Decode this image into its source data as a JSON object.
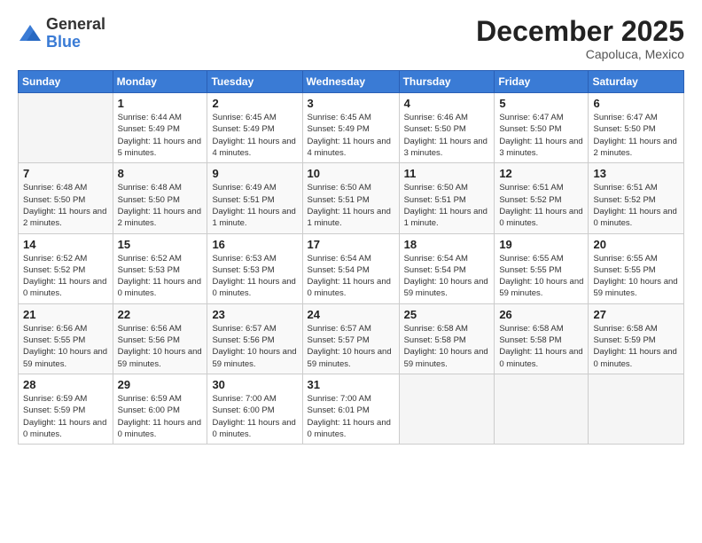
{
  "header": {
    "logo_general": "General",
    "logo_blue": "Blue",
    "month_title": "December 2025",
    "location": "Capoluca, Mexico"
  },
  "weekdays": [
    "Sunday",
    "Monday",
    "Tuesday",
    "Wednesday",
    "Thursday",
    "Friday",
    "Saturday"
  ],
  "weeks": [
    [
      {
        "day": "",
        "sunrise": "",
        "sunset": "",
        "daylight": ""
      },
      {
        "day": "1",
        "sunrise": "6:44 AM",
        "sunset": "5:49 PM",
        "daylight": "11 hours and 5 minutes."
      },
      {
        "day": "2",
        "sunrise": "6:45 AM",
        "sunset": "5:49 PM",
        "daylight": "11 hours and 4 minutes."
      },
      {
        "day": "3",
        "sunrise": "6:45 AM",
        "sunset": "5:49 PM",
        "daylight": "11 hours and 4 minutes."
      },
      {
        "day": "4",
        "sunrise": "6:46 AM",
        "sunset": "5:50 PM",
        "daylight": "11 hours and 3 minutes."
      },
      {
        "day": "5",
        "sunrise": "6:47 AM",
        "sunset": "5:50 PM",
        "daylight": "11 hours and 3 minutes."
      },
      {
        "day": "6",
        "sunrise": "6:47 AM",
        "sunset": "5:50 PM",
        "daylight": "11 hours and 2 minutes."
      }
    ],
    [
      {
        "day": "7",
        "sunrise": "6:48 AM",
        "sunset": "5:50 PM",
        "daylight": "11 hours and 2 minutes."
      },
      {
        "day": "8",
        "sunrise": "6:48 AM",
        "sunset": "5:50 PM",
        "daylight": "11 hours and 2 minutes."
      },
      {
        "day": "9",
        "sunrise": "6:49 AM",
        "sunset": "5:51 PM",
        "daylight": "11 hours and 1 minute."
      },
      {
        "day": "10",
        "sunrise": "6:50 AM",
        "sunset": "5:51 PM",
        "daylight": "11 hours and 1 minute."
      },
      {
        "day": "11",
        "sunrise": "6:50 AM",
        "sunset": "5:51 PM",
        "daylight": "11 hours and 1 minute."
      },
      {
        "day": "12",
        "sunrise": "6:51 AM",
        "sunset": "5:52 PM",
        "daylight": "11 hours and 0 minutes."
      },
      {
        "day": "13",
        "sunrise": "6:51 AM",
        "sunset": "5:52 PM",
        "daylight": "11 hours and 0 minutes."
      }
    ],
    [
      {
        "day": "14",
        "sunrise": "6:52 AM",
        "sunset": "5:52 PM",
        "daylight": "11 hours and 0 minutes."
      },
      {
        "day": "15",
        "sunrise": "6:52 AM",
        "sunset": "5:53 PM",
        "daylight": "11 hours and 0 minutes."
      },
      {
        "day": "16",
        "sunrise": "6:53 AM",
        "sunset": "5:53 PM",
        "daylight": "11 hours and 0 minutes."
      },
      {
        "day": "17",
        "sunrise": "6:54 AM",
        "sunset": "5:54 PM",
        "daylight": "11 hours and 0 minutes."
      },
      {
        "day": "18",
        "sunrise": "6:54 AM",
        "sunset": "5:54 PM",
        "daylight": "10 hours and 59 minutes."
      },
      {
        "day": "19",
        "sunrise": "6:55 AM",
        "sunset": "5:55 PM",
        "daylight": "10 hours and 59 minutes."
      },
      {
        "day": "20",
        "sunrise": "6:55 AM",
        "sunset": "5:55 PM",
        "daylight": "10 hours and 59 minutes."
      }
    ],
    [
      {
        "day": "21",
        "sunrise": "6:56 AM",
        "sunset": "5:55 PM",
        "daylight": "10 hours and 59 minutes."
      },
      {
        "day": "22",
        "sunrise": "6:56 AM",
        "sunset": "5:56 PM",
        "daylight": "10 hours and 59 minutes."
      },
      {
        "day": "23",
        "sunrise": "6:57 AM",
        "sunset": "5:56 PM",
        "daylight": "10 hours and 59 minutes."
      },
      {
        "day": "24",
        "sunrise": "6:57 AM",
        "sunset": "5:57 PM",
        "daylight": "10 hours and 59 minutes."
      },
      {
        "day": "25",
        "sunrise": "6:58 AM",
        "sunset": "5:58 PM",
        "daylight": "10 hours and 59 minutes."
      },
      {
        "day": "26",
        "sunrise": "6:58 AM",
        "sunset": "5:58 PM",
        "daylight": "11 hours and 0 minutes."
      },
      {
        "day": "27",
        "sunrise": "6:58 AM",
        "sunset": "5:59 PM",
        "daylight": "11 hours and 0 minutes."
      }
    ],
    [
      {
        "day": "28",
        "sunrise": "6:59 AM",
        "sunset": "5:59 PM",
        "daylight": "11 hours and 0 minutes."
      },
      {
        "day": "29",
        "sunrise": "6:59 AM",
        "sunset": "6:00 PM",
        "daylight": "11 hours and 0 minutes."
      },
      {
        "day": "30",
        "sunrise": "7:00 AM",
        "sunset": "6:00 PM",
        "daylight": "11 hours and 0 minutes."
      },
      {
        "day": "31",
        "sunrise": "7:00 AM",
        "sunset": "6:01 PM",
        "daylight": "11 hours and 0 minutes."
      },
      {
        "day": "",
        "sunrise": "",
        "sunset": "",
        "daylight": ""
      },
      {
        "day": "",
        "sunrise": "",
        "sunset": "",
        "daylight": ""
      },
      {
        "day": "",
        "sunrise": "",
        "sunset": "",
        "daylight": ""
      }
    ]
  ]
}
